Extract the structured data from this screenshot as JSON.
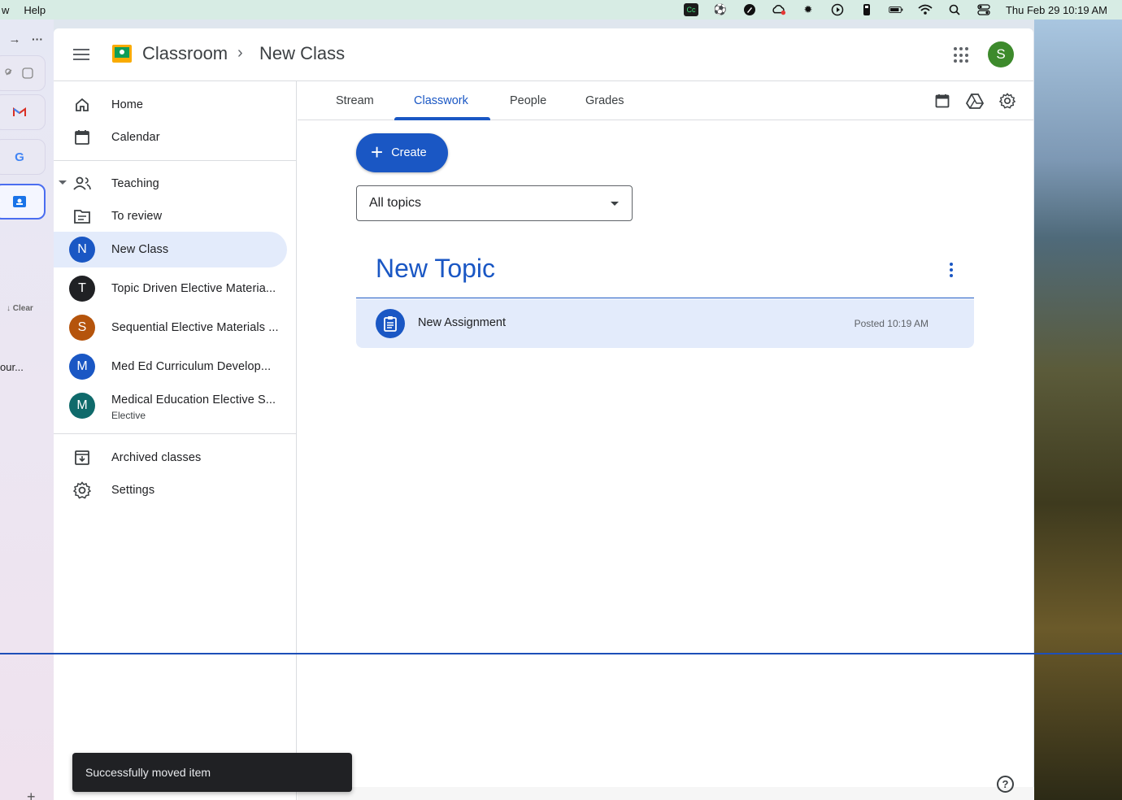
{
  "menubar": {
    "items": [
      "w",
      "Help"
    ],
    "clock": "Thu Feb 29  10:19 AM",
    "status_icons": [
      "cc-icon",
      "soccer-icon",
      "pen-icon",
      "creative-cloud-icon",
      "gear-burst-icon",
      "play-icon",
      "usb-icon",
      "battery-icon",
      "wifi-icon",
      "search-icon",
      "control-center-icon"
    ]
  },
  "browser_strip": {
    "clear_label": "↓ Clear",
    "tab_text": "our..."
  },
  "header": {
    "app_name": "Classroom",
    "separator": "›",
    "class_name": "New Class",
    "avatar_letter": "S"
  },
  "sidebar": {
    "home": "Home",
    "calendar": "Calendar",
    "teaching": "Teaching",
    "to_review": "To review",
    "classes": [
      {
        "letter": "N",
        "name": "New Class",
        "color": "#1a57c4",
        "selected": true
      },
      {
        "letter": "T",
        "name": "Topic Driven Elective Materia...",
        "color": "#202124"
      },
      {
        "letter": "S",
        "name": "Sequential Elective Materials ...",
        "color": "#b5540c"
      },
      {
        "letter": "M",
        "name": "Med Ed Curriculum Develop...",
        "color": "#1a57c4"
      },
      {
        "letter": "M",
        "name": "Medical Education Elective S...",
        "subtitle": "Elective",
        "color": "#0f6a6b"
      }
    ],
    "archived": "Archived classes",
    "settings": "Settings"
  },
  "tabs": [
    "Stream",
    "Classwork",
    "People",
    "Grades"
  ],
  "active_tab": "Classwork",
  "classwork": {
    "create_label": "Create",
    "topic_filter": "All topics",
    "topic_title": "New Topic",
    "assignment_title": "New Assignment",
    "assignment_posted": "Posted 10:19 AM"
  },
  "toast": "Successfully moved item",
  "help": "?",
  "colors": {
    "accent": "#1a57c4",
    "selected_bg": "#e3ebfb",
    "avatar_user": "#3d8a2c"
  }
}
